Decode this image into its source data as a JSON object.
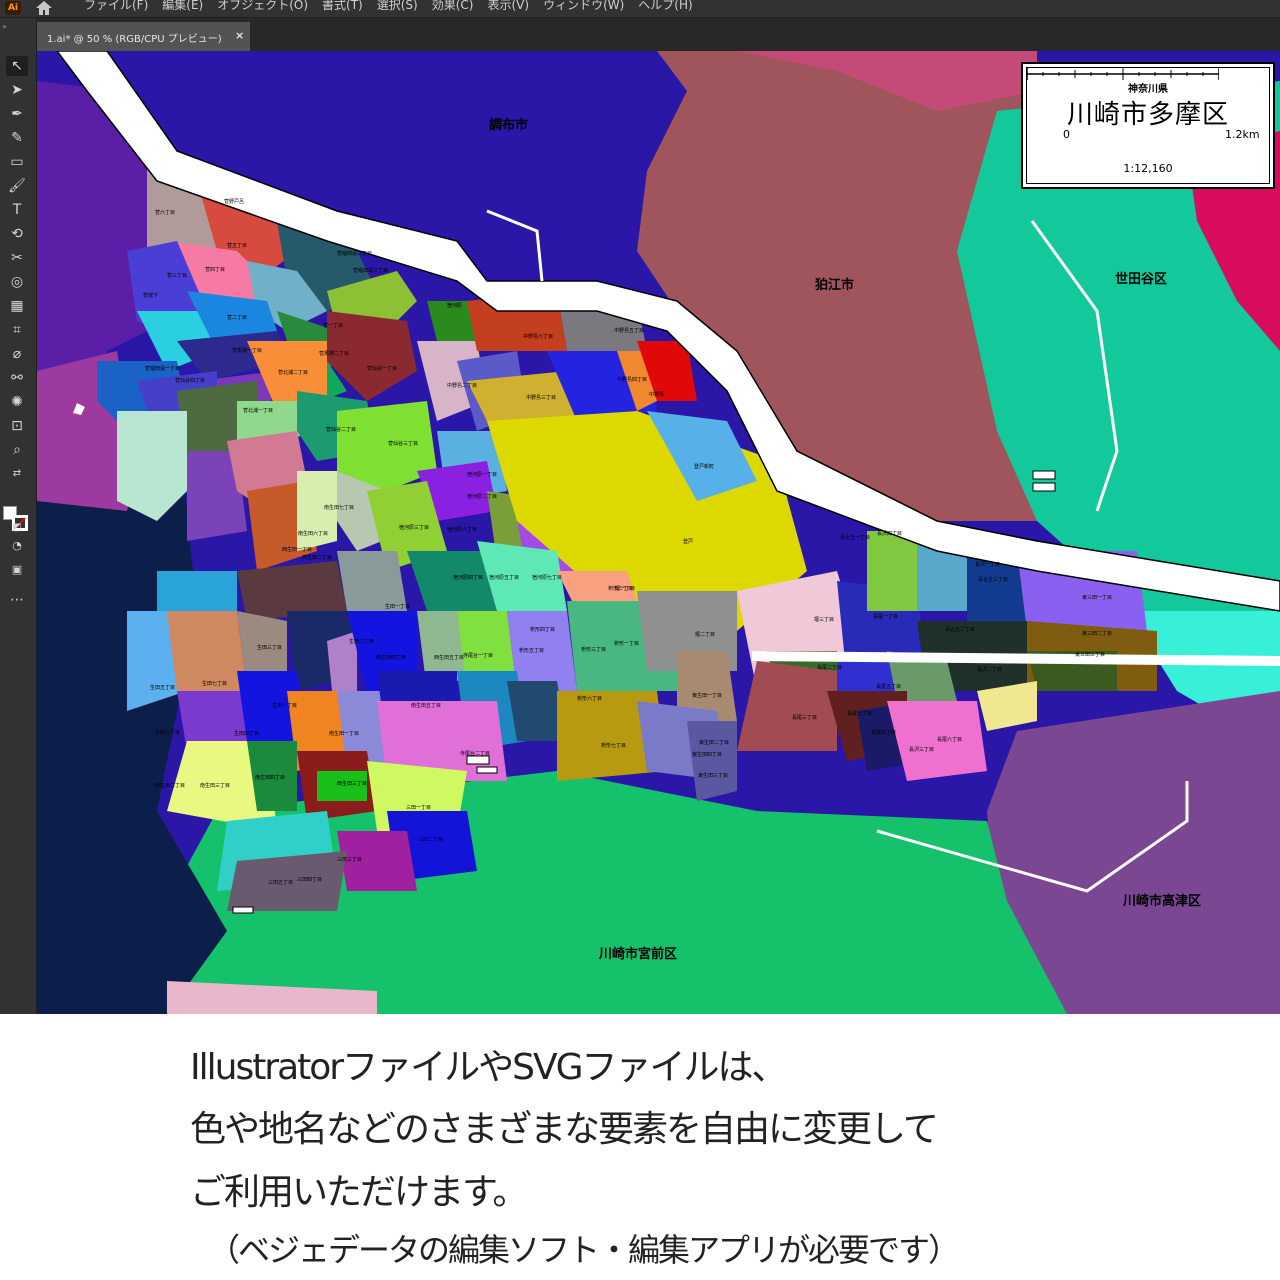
{
  "menubar": {
    "logo": "Ai",
    "items": [
      "ファイル(F)",
      "編集(E)",
      "オブジェクト(O)",
      "書式(T)",
      "選択(S)",
      "効果(C)",
      "表示(V)",
      "ウィンドウ(W)",
      "ヘルプ(H)"
    ]
  },
  "tab": {
    "title": "1.ai* @ 50 % (RGB/CPU プレビュー)",
    "close": "×"
  },
  "tools": [
    "selection-tool",
    "direct-selection-tool",
    "pen-tool",
    "curvature-tool",
    "rectangle-tool",
    "paintbrush-tool",
    "type-tool",
    "rotate-tool",
    "scissors-tool",
    "warp-tool",
    "gradient-tool",
    "eyedropper-tool",
    "blend-tool",
    "symbol-sprayer-tool",
    "artboard-tool",
    "slice-tool",
    "zoom-tool",
    "swap-colors",
    "fill-stroke",
    "screen-mode",
    "edit-toolbar"
  ],
  "map": {
    "neighbors": {
      "chofu": "調布市",
      "komae": "狛江市",
      "setagaya": "世田谷区",
      "miyamae": "川崎市宮前区",
      "takatsu": "川崎市高津区"
    },
    "towns": [
      "菅六丁目",
      "菅野戸呂",
      "菅五丁目",
      "菅稲田堤二丁目",
      "菅三丁目",
      "菅四丁目",
      "菅稲田堤三丁目",
      "宿河原",
      "菅二丁目",
      "菅一丁目",
      "中野島六丁目",
      "中野島五丁目",
      "菅城下",
      "菅北浦二丁目",
      "菅北浦一丁目",
      "菅馬場二丁目",
      "菅馬場一丁目",
      "菅仙谷一丁目",
      "中野島二丁目",
      "中野島三丁目",
      "中野島四丁目",
      "登戸新町",
      "登戸",
      "中野島",
      "菅仙谷二丁目",
      "菅稲田堤一丁目",
      "菅仙谷四丁目",
      "菅仙谷三丁目",
      "宿河原一丁目",
      "宿河原二丁目",
      "宿河原三丁目",
      "宿河原四丁目",
      "宿河原五丁目",
      "宿河原六丁目",
      "宿河原七丁目",
      "堰一丁目",
      "堰二丁目",
      "堰三丁目",
      "長尾一丁目",
      "長尾二丁目",
      "長尾三丁目",
      "長尾四丁目",
      "長尾五丁目",
      "長尾六丁目",
      "長尾七丁目",
      "枡形一丁目",
      "枡形二丁目",
      "枡形三丁目",
      "枡形四丁目",
      "枡形五丁目",
      "枡形六丁目",
      "枡形七丁目",
      "東生田一丁目",
      "東生田二丁目",
      "東生田三丁目",
      "東生田四丁目",
      "生田一丁目",
      "生田二丁目",
      "生田三丁目",
      "生田四丁目",
      "生田五丁目",
      "生田六丁目",
      "生田七丁目",
      "生田八丁目",
      "南生田一丁目",
      "南生田二丁目",
      "南生田三丁目",
      "南生田四丁目",
      "南生田五丁目",
      "南生田六丁目",
      "南生田七丁目",
      "西生田一丁目",
      "西生田二丁目",
      "西生田三丁目",
      "西生田四丁目",
      "西生田五丁目",
      "寺尾台一丁目",
      "寺尾台二丁目",
      "三田一丁目",
      "三田二丁目",
      "三田三丁目",
      "三田四丁目",
      "三田五丁目",
      "東三田一丁目",
      "東三田二丁目",
      "東三田三丁目",
      "長沢一丁目",
      "長沢二丁目",
      "長沢三丁目",
      "長沢四丁目",
      "百合丘一丁目",
      "百合丘二丁目",
      "百合丘三丁目"
    ],
    "scale": {
      "prefecture": "神奈川県",
      "title": "川崎市多摩区",
      "zero": "0",
      "max": "1.2km",
      "ratio": "1:12,160"
    }
  },
  "caption": {
    "line1": "IllustratorファイルやSVGファイルは、",
    "line2": "色や地名などのさまざまな要素を自由に変更して",
    "line3": "ご利用いただけます。",
    "line4": "（ベジェデータの編集ソフト・編集アプリが必要です）"
  }
}
